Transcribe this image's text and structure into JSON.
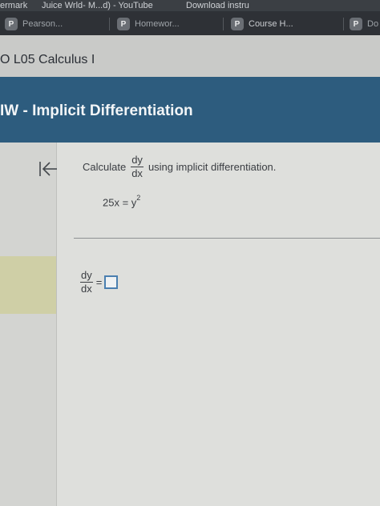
{
  "browser": {
    "bookmarks": [
      "ermark",
      "Juice Wrld- M...d) - YouTube",
      "Download instru"
    ],
    "tabs": [
      {
        "badge": "P",
        "label": "Pearson..."
      },
      {
        "badge": "P",
        "label": "Homewor..."
      },
      {
        "badge": "P",
        "label": "Course H..."
      },
      {
        "badge": "P",
        "label": "Do"
      }
    ]
  },
  "course": {
    "title": "O L05 Calculus I"
  },
  "assignment": {
    "title": "IW - Implicit Differentiation"
  },
  "question": {
    "prompt_prefix": "Calculate",
    "derivative_num": "dy",
    "derivative_den": "dx",
    "prompt_suffix": "using implicit differentiation.",
    "equation_lhs": "25x = y",
    "equation_exponent": "2",
    "answer_num": "dy",
    "answer_den": "dx",
    "answer_equals": "=",
    "answer_value": ""
  },
  "icons": {
    "collapse": "collapse-left-icon"
  },
  "colors": {
    "header_blue": "#2d5c7e",
    "answer_box_border": "#4a7fb0",
    "gutter_highlight": "#cfcfa6"
  }
}
